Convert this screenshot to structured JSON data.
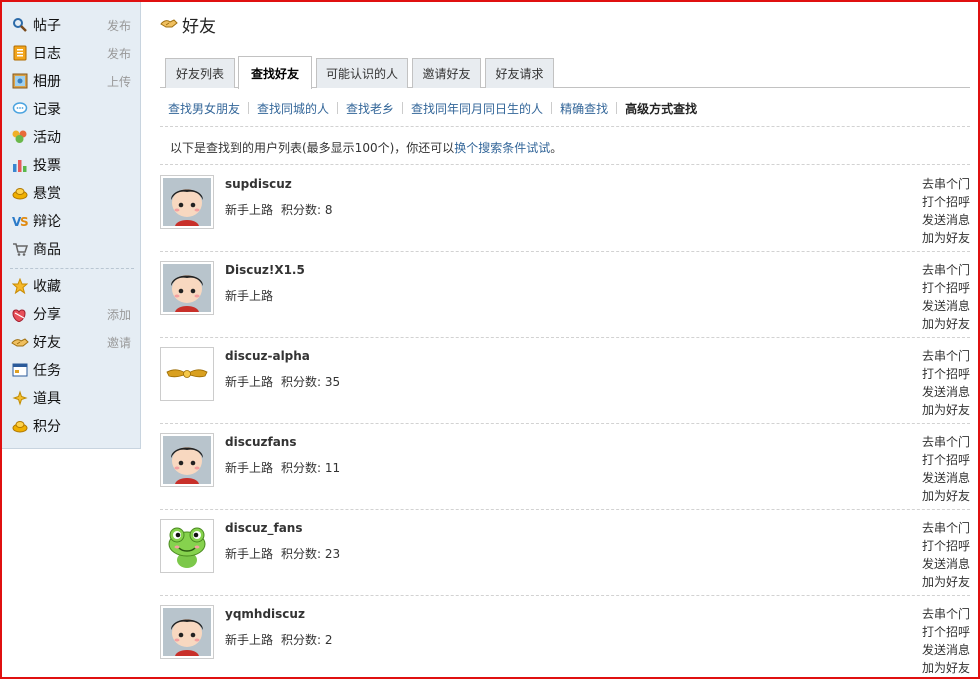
{
  "sidebar": {
    "items": [
      {
        "label": "帖子",
        "action": "发布",
        "icon": "post-icon"
      },
      {
        "label": "日志",
        "action": "发布",
        "icon": "blog-icon"
      },
      {
        "label": "相册",
        "action": "上传",
        "icon": "album-icon"
      },
      {
        "label": "记录",
        "action": "",
        "icon": "record-icon"
      },
      {
        "label": "活动",
        "action": "",
        "icon": "activity-icon"
      },
      {
        "label": "投票",
        "action": "",
        "icon": "poll-icon"
      },
      {
        "label": "悬赏",
        "action": "",
        "icon": "reward-icon"
      },
      {
        "label": "辩论",
        "action": "",
        "icon": "debate-icon"
      },
      {
        "label": "商品",
        "action": "",
        "icon": "goods-icon"
      },
      {
        "label": "收藏",
        "action": "",
        "icon": "favorite-icon"
      },
      {
        "label": "分享",
        "action": "添加",
        "icon": "share-icon"
      },
      {
        "label": "好友",
        "action": "邀请",
        "icon": "friends-icon"
      },
      {
        "label": "任务",
        "action": "",
        "icon": "task-icon"
      },
      {
        "label": "道具",
        "action": "",
        "icon": "magic-icon"
      },
      {
        "label": "积分",
        "action": "",
        "icon": "credits-icon"
      }
    ]
  },
  "page": {
    "title": "好友"
  },
  "tabs": [
    {
      "label": "好友列表"
    },
    {
      "label": "查找好友"
    },
    {
      "label": "可能认识的人"
    },
    {
      "label": "邀请好友"
    },
    {
      "label": "好友请求"
    }
  ],
  "subnav": [
    {
      "label": "查找男女朋友"
    },
    {
      "label": "查找同城的人"
    },
    {
      "label": "查找老乡"
    },
    {
      "label": "查找同年同月同日生的人"
    },
    {
      "label": "精确查找"
    },
    {
      "label": "高级方式查找"
    }
  ],
  "notice": {
    "prefix": "以下是查找到的用户列表(最多显示100个)，你还可以",
    "link": "换个搜索条件试试",
    "suffix": "。"
  },
  "users": [
    {
      "name": "supdiscuz",
      "level": "新手上路",
      "credits_label": "积分数: 8",
      "avatar": "boy"
    },
    {
      "name": "Discuz!X1.5",
      "level": "新手上路",
      "credits_label": "",
      "avatar": "boy"
    },
    {
      "name": "discuz-alpha",
      "level": "新手上路",
      "credits_label": "积分数: 35",
      "avatar": "wings"
    },
    {
      "name": "discuzfans",
      "level": "新手上路",
      "credits_label": "积分数: 11",
      "avatar": "boy"
    },
    {
      "name": "discuz_fans",
      "level": "新手上路",
      "credits_label": "积分数: 23",
      "avatar": "frog"
    },
    {
      "name": "yqmhdiscuz",
      "level": "新手上路",
      "credits_label": "积分数: 2",
      "avatar": "boy"
    }
  ],
  "user_actions": {
    "visit": "去串个门",
    "greet": "打个招呼",
    "message": "发送消息",
    "add": "加为好友"
  }
}
